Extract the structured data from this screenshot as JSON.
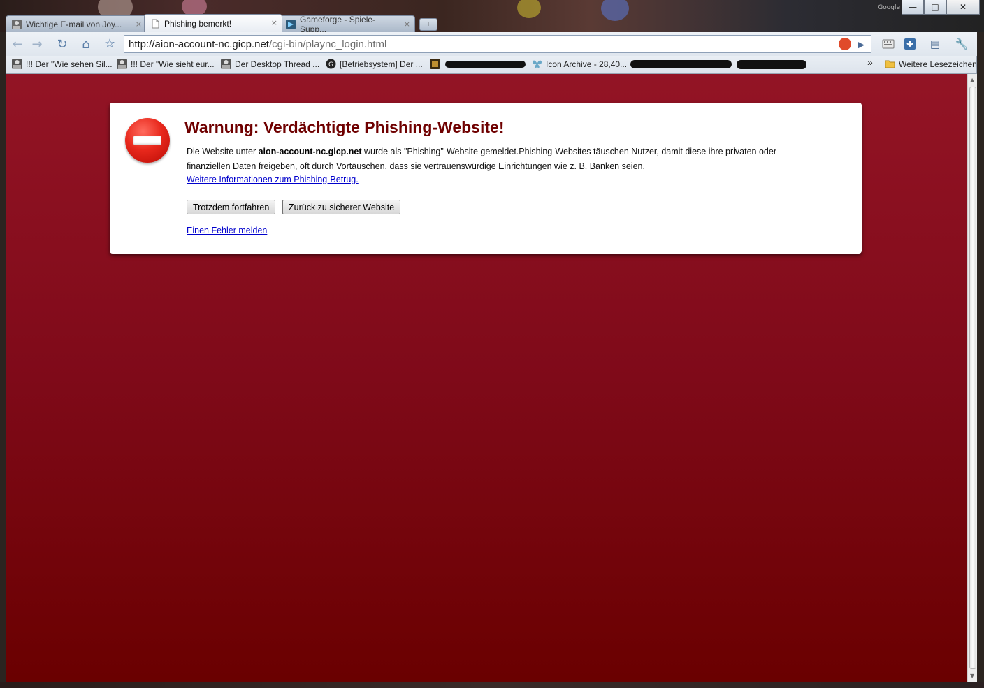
{
  "window": {
    "brand": "Google",
    "buttons": {
      "minimize": "—",
      "maximize": "□",
      "close": "✕"
    }
  },
  "tabs": [
    {
      "label": "Wichtige E-mail von Joy...",
      "active": false,
      "icon": "avatar-icon"
    },
    {
      "label": "Phishing bemerkt!",
      "active": true,
      "icon": "page-icon"
    },
    {
      "label": "Gameforge - Spiele-Supp...",
      "active": false,
      "icon": "gameforge-icon"
    }
  ],
  "tab_close_glyph": "×",
  "new_tab_glyph": "+",
  "toolbar": {
    "back": "←",
    "forward": "→",
    "reload": "↻",
    "home": "⌂",
    "star": "☆",
    "url_host": "http://aion-account-nc.gicp.net",
    "url_path": "/cgi-bin/plaync_login.html",
    "go": "▶",
    "page_menu": "▤",
    "tools_menu": "🔧"
  },
  "bookmarks": {
    "items": [
      {
        "label": "!!! Der \"Wie sehen Sil...",
        "icon": "avatar-icon"
      },
      {
        "label": "!!! Der \"Wie sieht eur...",
        "icon": "avatar-icon"
      },
      {
        "label": "Der Desktop Thread ...",
        "icon": "avatar-icon"
      },
      {
        "label": "[Betriebsystem] Der ...",
        "icon": "g-icon"
      },
      {
        "label": "Icon Archive - 28,40...",
        "icon": "butterfly-icon"
      }
    ],
    "overflow": "»",
    "other": "Weitere Lesezeichen"
  },
  "warning": {
    "title": "Warnung: Verdächtigte Phishing-Website!",
    "desc_before": "Die Website unter ",
    "desc_host": "aion-account-nc.gicp.net",
    "desc_after": " wurde als \"Phishing\"-Website gemeldet.Phishing-Websites täuschen Nutzer, damit diese ihre privaten oder finanziellen Daten freigeben, oft durch Vortäuschen, dass sie vertrauenswürdige Einrichtungen wie z. B. Banken seien.",
    "more_link": "Weitere Informationen zum Phishing-Betrug.",
    "proceed_button": "Trotzdem fortfahren",
    "back_button": "Zurück zu sicherer Website",
    "report_link": "Einen Fehler melden"
  },
  "colors": {
    "page_bg_top": "#931425",
    "page_bg_bottom": "#6a0000",
    "title_color": "#6f0000",
    "link_color": "#0000cc"
  }
}
